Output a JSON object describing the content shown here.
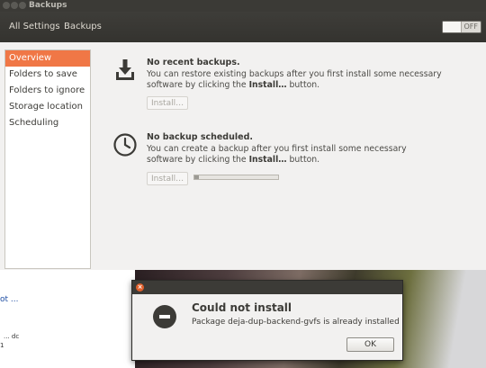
{
  "window": {
    "title": "Backups"
  },
  "toolbar": {
    "all_settings": "All Settings",
    "backups": "Backups",
    "toggle": "OFF"
  },
  "sidebar": {
    "items": [
      {
        "label": "Overview",
        "selected": true
      },
      {
        "label": "Folders to save"
      },
      {
        "label": "Folders to ignore"
      },
      {
        "label": "Storage location"
      },
      {
        "label": "Scheduling"
      }
    ]
  },
  "backups": {
    "heading": "No recent backups.",
    "desc_before": "You can restore existing backups after you first install some necessary software by clicking the ",
    "desc_bold": "Install…",
    "desc_after": " button.",
    "button": "Install…"
  },
  "schedule": {
    "heading": "No backup scheduled.",
    "desc_before": "You can create a backup after you first install some necessary software by clicking the ",
    "desc_bold": "Install…",
    "desc_after": " button.",
    "button": "Install…",
    "progress": 0.05
  },
  "background": {
    "link": "ot ...",
    "text1": "... dc",
    "text2": "1"
  },
  "dialog": {
    "heading": "Could not install",
    "message": "Package deja-dup-backend-gvfs is already installed",
    "ok": "OK"
  }
}
